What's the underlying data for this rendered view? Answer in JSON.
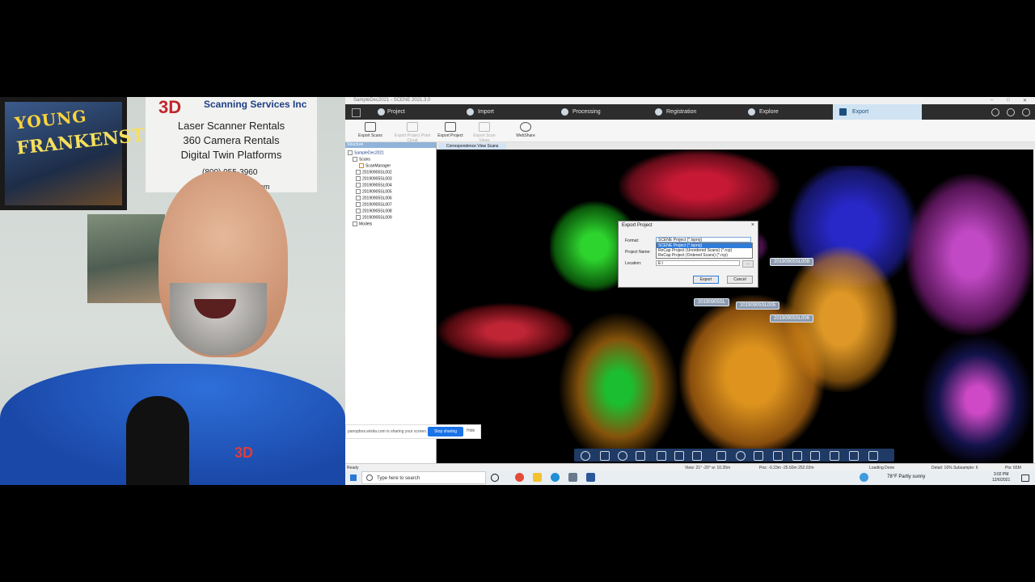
{
  "webcam": {
    "poster": {
      "title": "YOUNG",
      "subtitle": "FRANKENSTEIN"
    },
    "sign": {
      "logo": "3D",
      "brand": "Scanning Services Inc",
      "lines": [
        "Laser Scanner Rentals",
        "360 Camera Rentals",
        "Digital Twin Platforms"
      ],
      "phone": "(800) 955-3960",
      "site": ".com"
    },
    "shirt_logo": "3D"
  },
  "app": {
    "window_title": "SampleDec2021 - SCENE 2021.3.0",
    "window_controls": [
      "–",
      "□",
      "✕"
    ],
    "ribbon_tabs": [
      {
        "label": "Project",
        "active": false
      },
      {
        "label": "Import",
        "active": false
      },
      {
        "label": "Processing",
        "active": false
      },
      {
        "label": "Registration",
        "active": false
      },
      {
        "label": "Explore",
        "active": false
      },
      {
        "label": "Export",
        "active": true
      }
    ],
    "ribbon_buttons": [
      {
        "label": "Export Scans",
        "enabled": true
      },
      {
        "label": "Export Project Point Cloud",
        "enabled": false
      },
      {
        "label": "Export Project",
        "enabled": true
      },
      {
        "label": "Export Scan Views",
        "enabled": false
      },
      {
        "label": "WebShare",
        "enabled": true
      }
    ],
    "structure": {
      "header": "Structure",
      "root": "SampleDec2021",
      "scans_folder": "Scans",
      "scan_manager": "ScanManager",
      "scans": [
        "20190905SL002",
        "20190905SL003",
        "20190905SL004",
        "20190905SL005",
        "20190905SL006",
        "20190905SL007",
        "20190905SL008",
        "20190905SL009"
      ],
      "models": "Models"
    },
    "view_tab": "Correspondence View Scans",
    "scan_labels": [
      "20190905SL008",
      "20190905SL",
      "20190905SL005",
      "20190905SL006"
    ],
    "dialog": {
      "title": "Export Project",
      "format_label": "Format:",
      "format_value": "SCENE Project (*.lsproj)",
      "format_options": [
        "SCENE Project (*.lsproj)",
        "ReCap Project (Unordered Scans) (*.rcp)",
        "ReCap Project (Ordered Scans) (*.rcp)"
      ],
      "project_name_label": "Project Name:",
      "location_label": "Location:",
      "location_value": "E:\\",
      "browse": "...",
      "export_button": "Export",
      "cancel_button": "Cancel"
    },
    "share": {
      "text": "panopbox.wistia.com is sharing your screen.",
      "stop": "Stop sharing",
      "hide": "Hide"
    },
    "status": {
      "ready": "Ready",
      "view": "View: 21° -20° w: 10.35m",
      "pos": "Pos: -0.23m -25.60m 252.02m",
      "loading": "Loading Done",
      "detail": "Detail: 16%  Subsample: 6",
      "pts": "Pts: 65M"
    },
    "taskbar": {
      "search_placeholder": "Type here to search",
      "weather": "78°F  Partly sunny",
      "time": "3:02 PM",
      "date": "12/6/2021"
    }
  }
}
